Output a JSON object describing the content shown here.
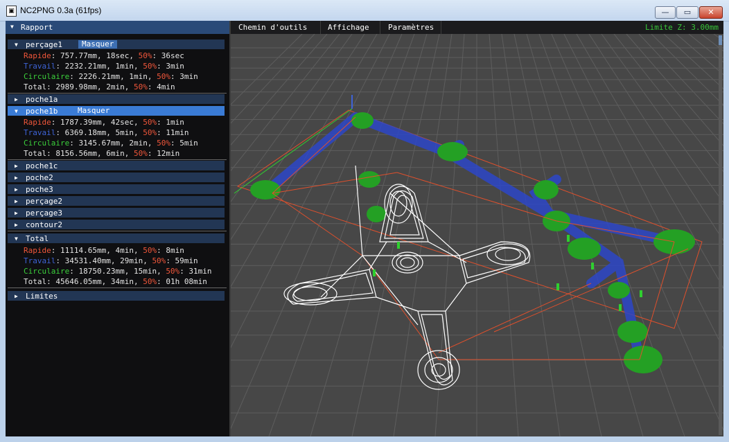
{
  "window": {
    "title": "NC2PNG 0.3a (61fps)",
    "min_glyph": "—",
    "max_glyph": "▭",
    "close_glyph": "✕"
  },
  "panel": {
    "title": "Rapport"
  },
  "labels": {
    "rapide": "Rapide",
    "travail": "Travail",
    "circulaire": "Circulaire",
    "total": "Total",
    "half": "50%"
  },
  "sections": {
    "percage1": {
      "name": "perçage1",
      "button": "Masquer",
      "rapide": ": 757.77mm, 18sec, ",
      "rapide50": ": 36sec",
      "travail": ": 2232.21mm, 1min, ",
      "travail50": ": 3min",
      "circulaire": ": 2226.21mm, 1min, ",
      "circulaire50": ": 3min",
      "total": ": 2989.98mm, 2min, ",
      "total50": ": 4min"
    },
    "poche1a": {
      "name": "poche1a"
    },
    "poche1b": {
      "name": "poche1b",
      "button": "Masquer",
      "rapide": ": 1787.39mm, 42sec, ",
      "rapide50": ": 1min",
      "travail": ": 6369.18mm, 5min, ",
      "travail50": ": 11min",
      "circulaire": ": 3145.67mm, 2min, ",
      "circulaire50": ": 5min",
      "total": ": 8156.56mm, 6min, ",
      "total50": ": 12min"
    },
    "others": [
      "poche1c",
      "poche2",
      "poche3",
      "perçage2",
      "perçage3",
      "contour2"
    ],
    "total": {
      "name": "Total",
      "rapide": ": 11114.65mm, 4min, ",
      "rapide50": ": 8min",
      "travail": ": 34531.40mm, 29min, ",
      "travail50": ": 59min",
      "circulaire": ": 18750.23mm, 15min, ",
      "circulaire50": ": 31min",
      "total": ": 45646.05mm, 34min, ",
      "total50": ": 01h 08min"
    },
    "limites": {
      "name": "Limites"
    }
  },
  "menu": {
    "items": [
      "Chemin d'outils",
      "Affichage",
      "Paramètres"
    ],
    "limit": "Limite Z: 3.00mm"
  },
  "colors": {
    "rapide": "#f0563a",
    "travail": "#3e63d6",
    "circulaire": "#3bd13b",
    "accent": "#3a7bd5"
  },
  "icons": [
    "app-icon",
    "expand-triangle-icon",
    "collapse-triangle-icon"
  ]
}
